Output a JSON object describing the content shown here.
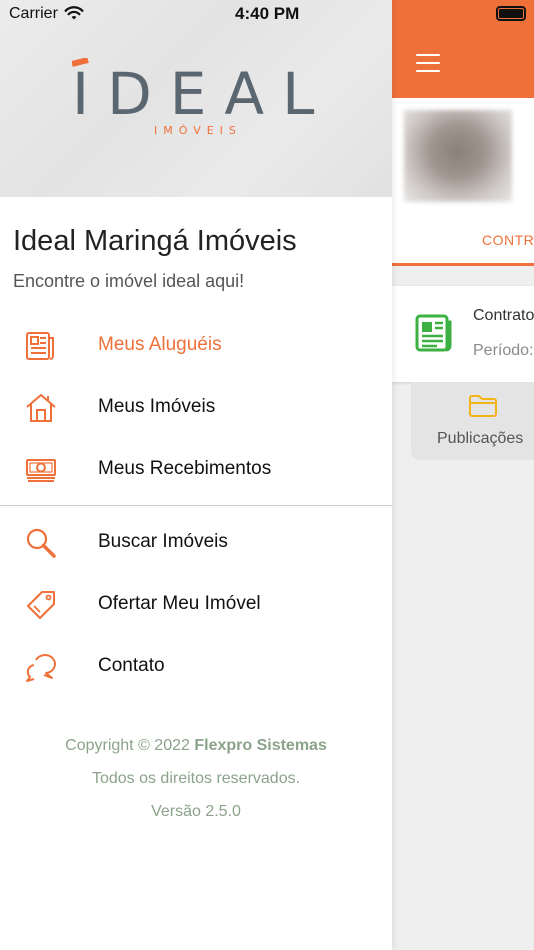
{
  "status_bar": {
    "carrier": "Carrier",
    "time": "4:40 PM"
  },
  "drawer": {
    "logo_text": "IDEAL",
    "logo_subtext": "IMÓVEIS",
    "company_name": "Ideal Maringá Imóveis",
    "tagline": "Encontre o imóvel ideal aqui!",
    "menu_primary": [
      {
        "label": "Meus Aluguéis",
        "icon": "newspaper-icon",
        "active": true
      },
      {
        "label": "Meus Imóveis",
        "icon": "house-icon",
        "active": false
      },
      {
        "label": "Meus Recebimentos",
        "icon": "money-icon",
        "active": false
      }
    ],
    "menu_secondary": [
      {
        "label": "Buscar Imóveis",
        "icon": "search-icon"
      },
      {
        "label": "Ofertar Meu Imóvel",
        "icon": "tag-icon"
      },
      {
        "label": "Contato",
        "icon": "chat-bubbles-icon"
      }
    ],
    "footer": {
      "copyright_prefix": "Copyright © 2022",
      "copyright_company": "Flexpro Sistemas",
      "rights": "Todos os direitos reservados.",
      "version": "Versão 2.5.0"
    }
  },
  "main": {
    "tab_label": "CONTR",
    "contract_title": "Contrato",
    "contract_period": "Período:",
    "publications_label": "Publicações"
  },
  "colors": {
    "accent": "#f0703a",
    "footer_text": "#8ba38a",
    "contract_icon": "#3cb043",
    "folder_icon": "#f2b417"
  }
}
